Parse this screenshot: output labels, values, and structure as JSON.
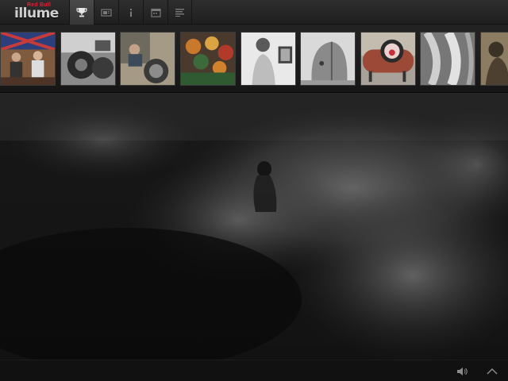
{
  "app": {
    "logo_brand": "Red Bull",
    "logo_word": "illume"
  },
  "nav": {
    "items": [
      {
        "icon": "trophy-icon",
        "active": true
      },
      {
        "icon": "gallery-icon",
        "active": false
      },
      {
        "icon": "info-icon",
        "active": false
      },
      {
        "icon": "calendar-icon",
        "active": false
      },
      {
        "icon": "list-icon",
        "active": false
      }
    ]
  },
  "thumbnails": {
    "count": 9,
    "style": [
      "color",
      "bw",
      "sepia",
      "color",
      "bw",
      "bw",
      "color",
      "bw",
      "sepia"
    ]
  },
  "footer": {
    "icons": [
      "speaker-icon",
      "chevron-up-icon"
    ]
  },
  "colors": {
    "brand": "#d6253a",
    "bar": "#232323",
    "active_tab": "#404040"
  }
}
